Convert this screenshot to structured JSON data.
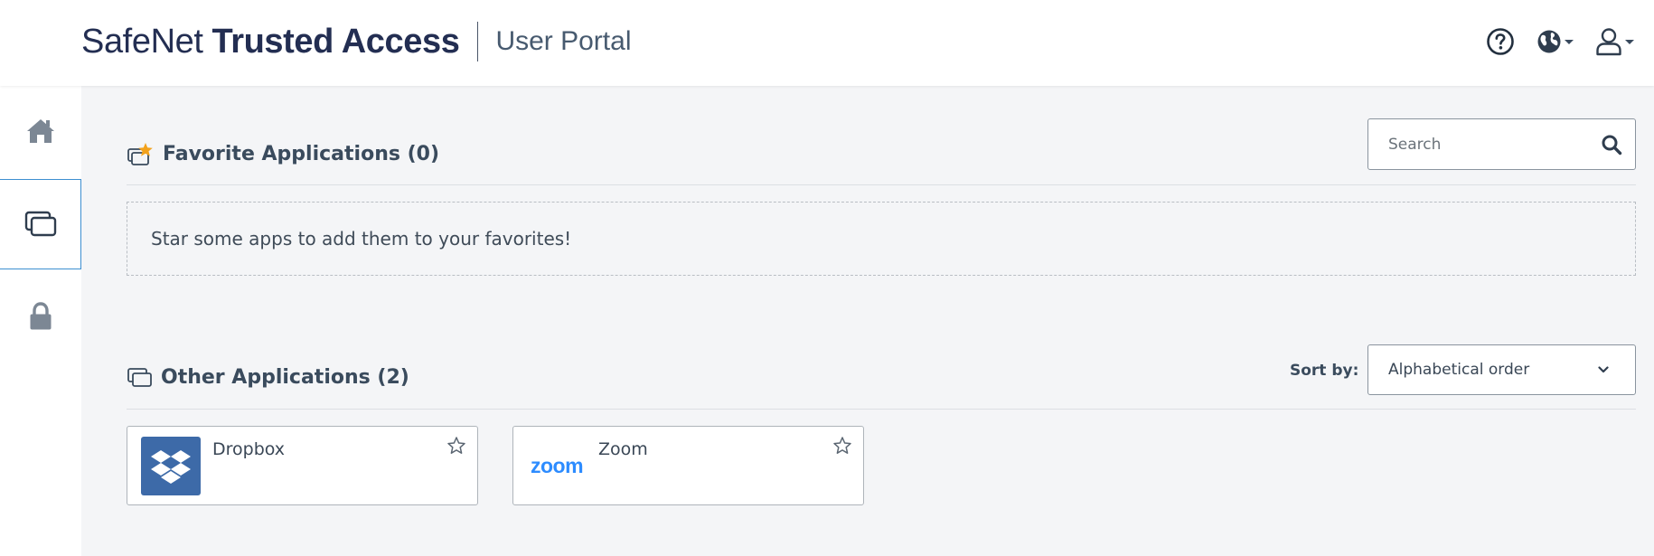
{
  "header": {
    "brand_light": "SafeNet",
    "brand_bold": "Trusted Access",
    "portal_title": "User Portal",
    "icons": [
      "help-icon",
      "globe-icon",
      "user-icon"
    ]
  },
  "sidebar": {
    "items": [
      {
        "name": "home",
        "icon": "home-icon",
        "active": false
      },
      {
        "name": "applications",
        "icon": "applications-icon",
        "active": true
      },
      {
        "name": "security",
        "icon": "lock-icon",
        "active": false
      }
    ]
  },
  "favorites": {
    "title": "Favorite Applications (0)",
    "empty_message": "Star some apps to add them to your favorites!"
  },
  "search": {
    "placeholder": "Search"
  },
  "other": {
    "title": "Other Applications (2)",
    "sort_label": "Sort by:",
    "sort_value": "Alphabetical order",
    "apps": [
      {
        "name": "Dropbox",
        "logo": "dropbox-logo",
        "favorite": false
      },
      {
        "name": "Zoom",
        "logo": "zoom-logo",
        "logo_text": "zoom",
        "favorite": false
      }
    ]
  },
  "colors": {
    "accent": "#3d8fd1",
    "brand": "#232e52",
    "star": "#f3a21b",
    "dropbox": "#3d6aa8",
    "zoom": "#2d8cff"
  }
}
